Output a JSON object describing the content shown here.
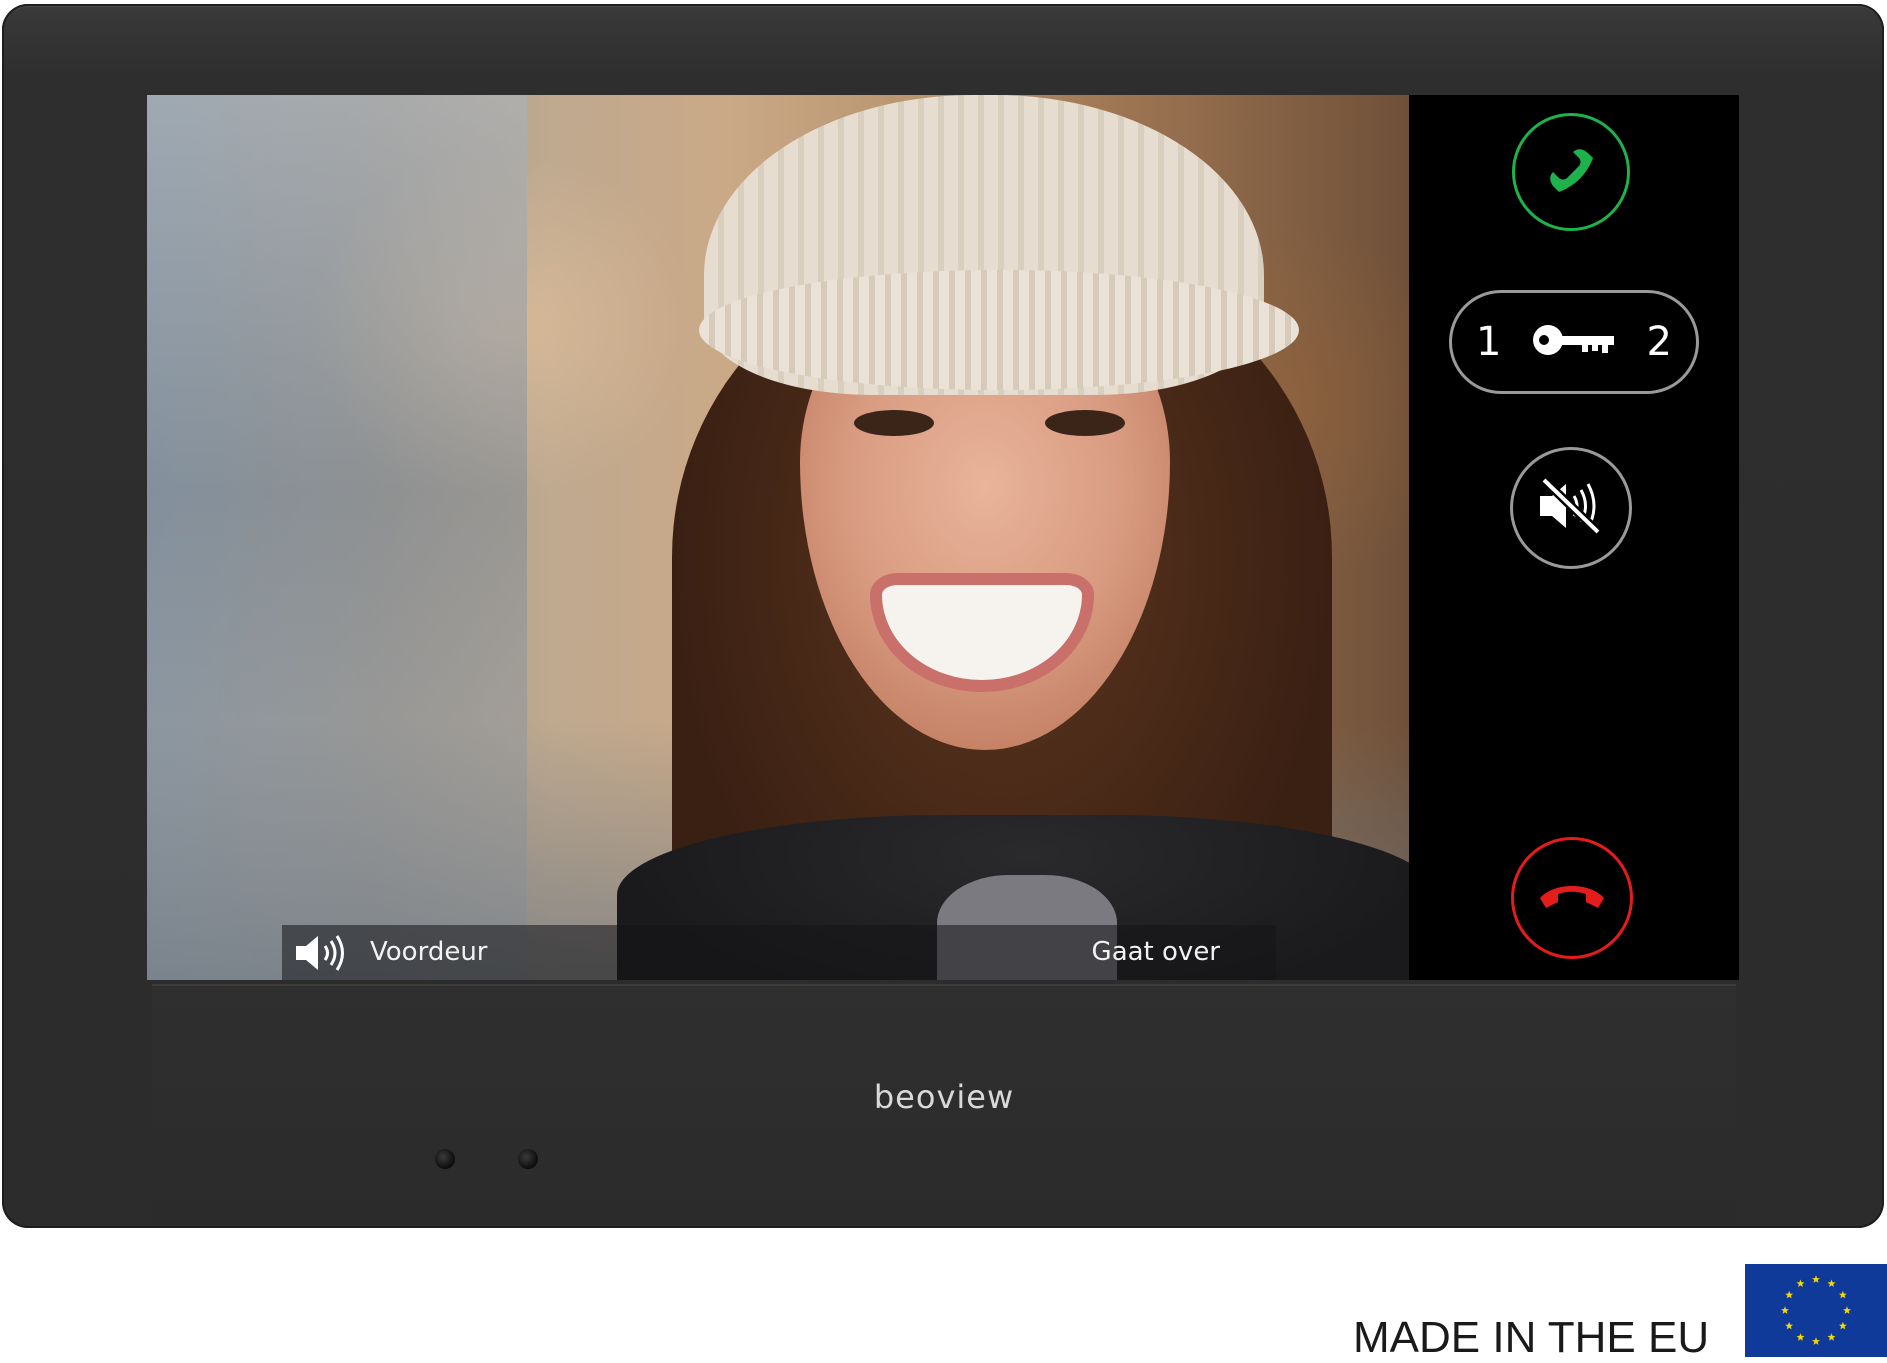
{
  "screen": {
    "status_bar": {
      "left_label": "Voordeur",
      "right_label": "Gaat over",
      "icon": "speaker-icon"
    },
    "controls": {
      "answer": {
        "icon": "phone-answer-icon",
        "color": "#1db24b"
      },
      "door_release": {
        "left_number": "1",
        "right_number": "2",
        "icon": "key-icon"
      },
      "mute": {
        "icon": "speaker-muted-icon"
      },
      "hangup": {
        "icon": "phone-hangup-icon",
        "color": "#e41c1c"
      }
    }
  },
  "device": {
    "brand": "beoview"
  },
  "footer": {
    "made_in": "MADE IN THE EU",
    "flag_icon": "eu-flag-icon",
    "flag_color": "#103a9a",
    "star_color": "#f5d800"
  }
}
